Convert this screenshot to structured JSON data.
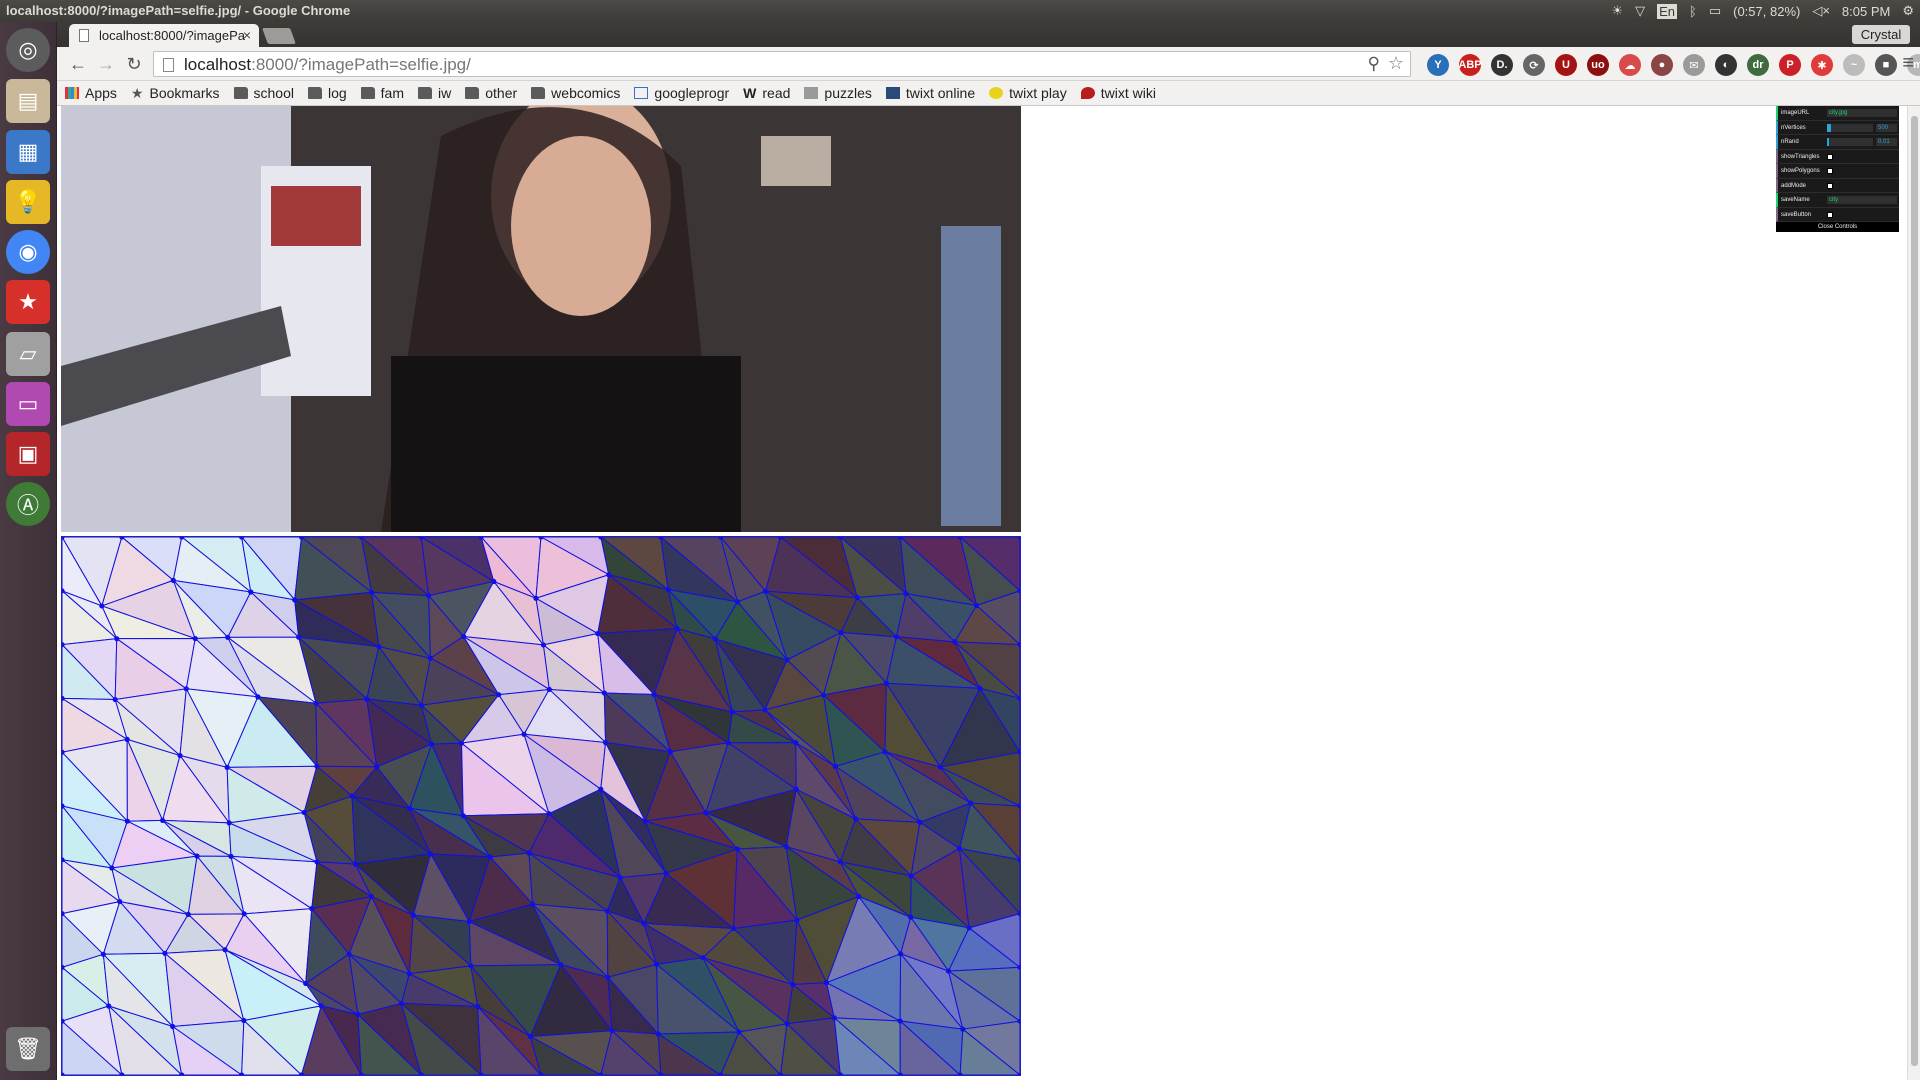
{
  "os": {
    "window_title": "localhost:8000/?imagePath=selfie.jpg/ - Google Chrome",
    "tray": {
      "language": "En",
      "battery": "(0:57, 82%)",
      "clock": "8:05 PM"
    }
  },
  "launcher": {
    "items": [
      "ubuntu-dash",
      "files",
      "text-editor",
      "idea",
      "chrome",
      "bookmarks-app",
      "scanner",
      "window-app",
      "presentation",
      "software-updater",
      "trash"
    ]
  },
  "browser": {
    "tab_title": "localhost:8000/?imagePa",
    "profile": "Crystal",
    "url_host": "localhost",
    "url_rest": ":8000/?imagePath=selfie.jpg/",
    "extensions": [
      {
        "name": "y-ext-icon",
        "label": "Y",
        "color": "#2a6fb8"
      },
      {
        "name": "adblock-plus-icon",
        "label": "ABP",
        "color": "#c8201c"
      },
      {
        "name": "d-ext-icon",
        "label": "D.",
        "color": "#333333"
      },
      {
        "name": "sync-ext-icon",
        "label": "⟳",
        "color": "#666666"
      },
      {
        "name": "u-ext-icon",
        "label": "U",
        "color": "#a51212"
      },
      {
        "name": "ublock-icon",
        "label": "uo",
        "color": "#8d0f0f"
      },
      {
        "name": "cloud-ext-icon",
        "label": "☁",
        "color": "#d94b4b"
      },
      {
        "name": "camera-ext-icon",
        "label": "●",
        "color": "#8a4545"
      },
      {
        "name": "mail-ext-icon",
        "label": "✉",
        "color": "#9a9a9a"
      },
      {
        "name": "contrast-ext-icon",
        "label": "◐",
        "color": "#333333"
      },
      {
        "name": "dr-ext-icon",
        "label": "dr",
        "color": "#3f6b3f"
      },
      {
        "name": "pinterest-icon",
        "label": "P",
        "color": "#cb2027"
      },
      {
        "name": "asterisk-ext-icon",
        "label": "✱",
        "color": "#e03a3a"
      },
      {
        "name": "feather-ext-icon",
        "label": "~",
        "color": "#bcbcbc"
      },
      {
        "name": "square-ext-icon",
        "label": "■",
        "color": "#555555"
      },
      {
        "name": "m-ext-icon",
        "label": "m",
        "color": "#b8b8b8"
      }
    ],
    "bookmarks": [
      {
        "label": "Apps",
        "icon": "apps-grid-icon"
      },
      {
        "label": "Bookmarks",
        "icon": "star-icon"
      },
      {
        "label": "school",
        "icon": "folder-icon"
      },
      {
        "label": "log",
        "icon": "folder-icon"
      },
      {
        "label": "fam",
        "icon": "folder-icon"
      },
      {
        "label": "iw",
        "icon": "folder-icon"
      },
      {
        "label": "other",
        "icon": "folder-icon"
      },
      {
        "label": "webcomics",
        "icon": "folder-icon"
      },
      {
        "label": "googleprogr",
        "icon": "page-icon"
      },
      {
        "label": "read",
        "icon": "wikipedia-icon"
      },
      {
        "label": "puzzles",
        "icon": "puzzle-icon"
      },
      {
        "label": "twixt online",
        "icon": "twixt-icon"
      },
      {
        "label": "twixt play",
        "icon": "twixt-play-icon"
      },
      {
        "label": "twixt wiki",
        "icon": "twixt-wiki-icon"
      }
    ]
  },
  "gui": {
    "rows": [
      {
        "label": "imageURL",
        "type": "str",
        "value": "city.jpg"
      },
      {
        "label": "nVertices",
        "type": "slider",
        "value": "500",
        "fill": 0.08
      },
      {
        "label": "nRand",
        "type": "slider",
        "value": "0.01",
        "fill": 0.0
      },
      {
        "label": "showTriangles",
        "type": "bool"
      },
      {
        "label": "showPolygons",
        "type": "bool"
      },
      {
        "label": "addMode",
        "type": "bool"
      },
      {
        "label": "saveName",
        "type": "str",
        "value": "city"
      },
      {
        "label": "saveButton",
        "type": "bool"
      }
    ],
    "close_label": "Close Controls"
  },
  "colors": {
    "ubuntu_panel": "#3c3b37",
    "launcher": "#4a3a43",
    "mesh_edge": "#1010e0",
    "gui_bg": "#1a1a1a"
  }
}
